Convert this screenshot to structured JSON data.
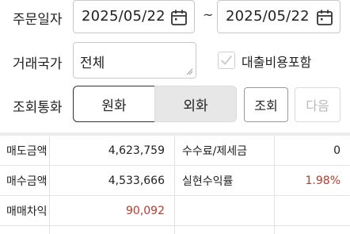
{
  "order_date": {
    "label": "주문일자",
    "from": "2025/05/22",
    "separator": "~",
    "to": "2025/05/22"
  },
  "country": {
    "label": "거래국가",
    "value": "전체"
  },
  "loan_cost": {
    "label": "대출비용포함",
    "checked": true
  },
  "currency": {
    "label": "조회통화",
    "options": [
      "원화",
      "외화"
    ],
    "selected": "원화"
  },
  "buttons": {
    "query": "조회",
    "next": "다음"
  },
  "summary": {
    "rows": [
      {
        "label1": "매도금액",
        "value1": "4,623,759",
        "label2": "수수료/제세금",
        "value2": "0"
      },
      {
        "label1": "매수금액",
        "value1": "4,533,666",
        "label2": "실현수익률",
        "value2": "1.98%"
      },
      {
        "label1": "매매차익",
        "value1": "90,092",
        "label2": "",
        "value2": ""
      }
    ]
  },
  "colors": {
    "profit": "#c0392b",
    "segment_selected_border": "#333333",
    "segment_unselected_bg": "#e7e7e7"
  }
}
